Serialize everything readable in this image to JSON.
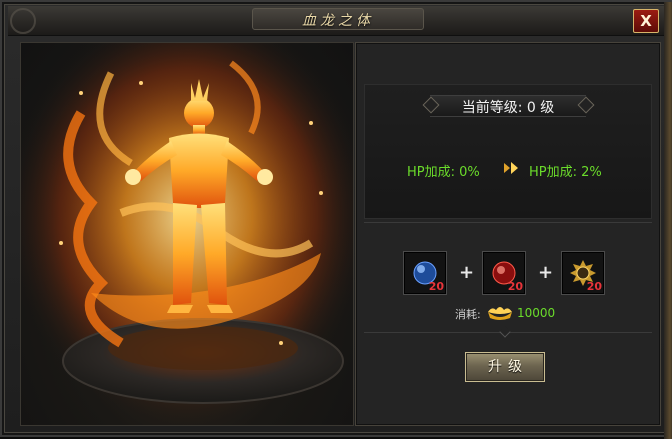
{
  "window": {
    "title": "血龙之体",
    "close_label": "X"
  },
  "level": {
    "label": "当前等级: 0 级"
  },
  "stats": {
    "current": "HP加成: 0%",
    "next": "HP加成: 2%"
  },
  "materials": {
    "items": [
      {
        "icon": "blue-orb-icon",
        "count": "20"
      },
      {
        "icon": "red-orb-icon",
        "count": "20"
      },
      {
        "icon": "gold-medallion-icon",
        "count": "20"
      }
    ],
    "plus": "+"
  },
  "cost": {
    "label": "消耗:",
    "icon": "gold-ingot-icon",
    "value": "10000"
  },
  "actions": {
    "upgrade_label": "升级"
  },
  "colors": {
    "stat_green": "#6bdc2b",
    "count_red": "#e8343a",
    "title_gold": "#e9d8a8"
  }
}
